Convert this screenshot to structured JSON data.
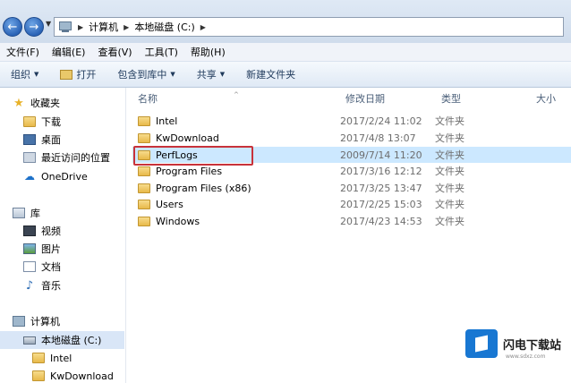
{
  "address": {
    "crumbs": [
      "计算机",
      "本地磁盘 (C:)"
    ]
  },
  "menu": [
    "文件(F)",
    "编辑(E)",
    "查看(V)",
    "工具(T)",
    "帮助(H)"
  ],
  "toolbar": {
    "organize": "组织",
    "open": "打开",
    "include_library": "包含到库中",
    "share": "共享",
    "new_folder": "新建文件夹"
  },
  "nav": {
    "favorites": "收藏夹",
    "downloads": "下载",
    "desktop": "桌面",
    "recent": "最近访问的位置",
    "onedrive": "OneDrive",
    "libraries": "库",
    "videos": "视频",
    "pictures": "图片",
    "documents": "文档",
    "music": "音乐",
    "computer": "计算机",
    "local_disk": "本地磁盘 (C:)",
    "sub_intel": "Intel",
    "sub_kwdownload": "KwDownload"
  },
  "columns": {
    "name": "名称",
    "modified": "修改日期",
    "type": "类型",
    "size": "大小"
  },
  "files": [
    {
      "name": "Intel",
      "modified": "2017/2/24 11:02",
      "type": "文件夹"
    },
    {
      "name": "KwDownload",
      "modified": "2017/4/8 13:07",
      "type": "文件夹"
    },
    {
      "name": "PerfLogs",
      "modified": "2009/7/14 11:20",
      "type": "文件夹"
    },
    {
      "name": "Program Files",
      "modified": "2017/3/16 12:12",
      "type": "文件夹"
    },
    {
      "name": "Program Files (x86)",
      "modified": "2017/3/25 13:47",
      "type": "文件夹"
    },
    {
      "name": "Users",
      "modified": "2017/2/25 15:03",
      "type": "文件夹"
    },
    {
      "name": "Windows",
      "modified": "2017/4/23 14:53",
      "type": "文件夹"
    }
  ],
  "watermark": {
    "name": "闪电下载站",
    "url": "www.sdxz.com"
  }
}
